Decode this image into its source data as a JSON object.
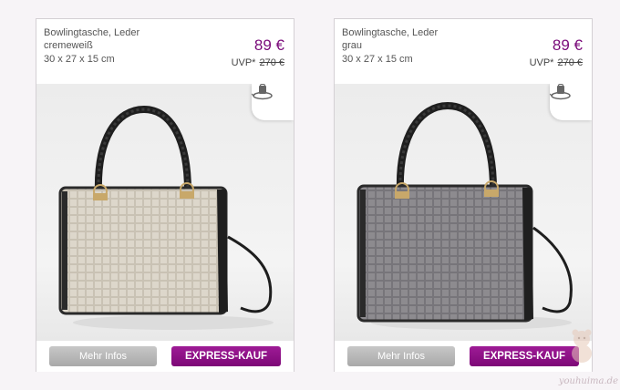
{
  "products": [
    {
      "title": "Bowlingtasche, Leder",
      "color": "cremeweiß",
      "size": "30 x 27 x 15 cm",
      "price": "89 €",
      "uvp_label": "UVP*",
      "uvp_price": "270 €",
      "more_label": "Mehr Infos",
      "express_label": "EXPRESS-KAUF",
      "bag_body_color": "#ddd7cb",
      "bag_stripe_color": "#cfc8ba"
    },
    {
      "title": "Bowlingtasche, Leder",
      "color": "grau",
      "size": "30 x 27 x 15 cm",
      "price": "89 €",
      "uvp_label": "UVP*",
      "uvp_price": "270 €",
      "more_label": "Mehr Infos",
      "express_label": "EXPRESS-KAUF",
      "bag_body_color": "#8d8b8f",
      "bag_stripe_color": "#7c7a7e"
    }
  ],
  "watermark": "youhuima.de",
  "colors": {
    "accent": "#7a0a7a",
    "button_grey": "#b3b3b3"
  },
  "icons": {
    "rotate": "rotate-360-icon"
  }
}
